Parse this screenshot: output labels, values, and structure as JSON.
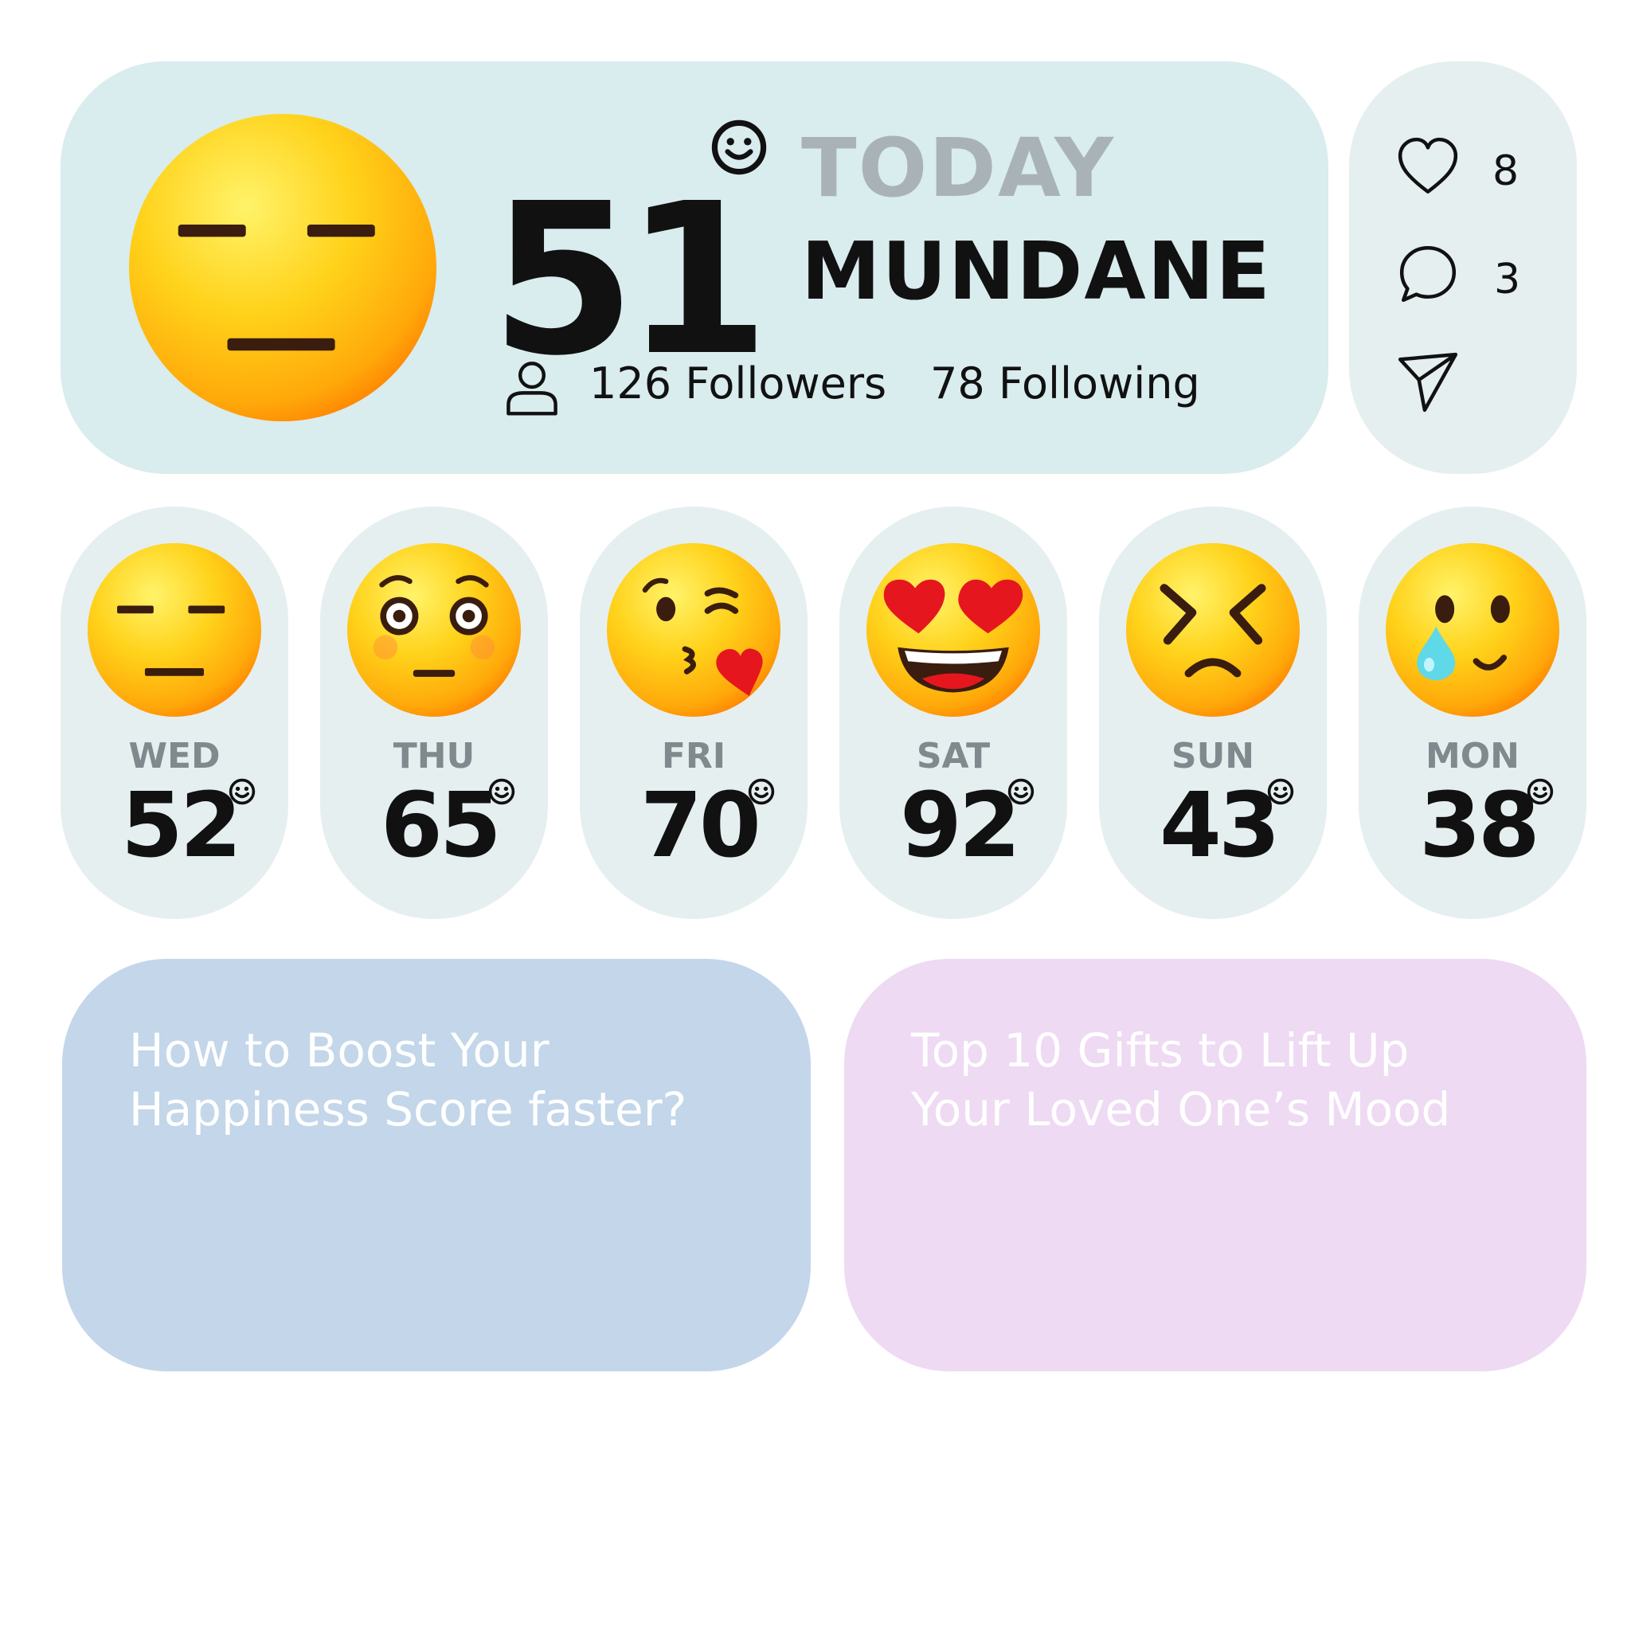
{
  "main": {
    "score": "51",
    "today_label": "TODAY",
    "mood_label": "MUNDANE",
    "followers": "126 Followers",
    "following": "78 Following",
    "emoji_icon": "neutral-face-icon"
  },
  "side": {
    "likes": "8",
    "comments": "3",
    "icons": [
      "heart-icon",
      "comment-icon",
      "send-icon"
    ]
  },
  "days": [
    {
      "name": "WED",
      "score": "52",
      "emoji": "neutral-face-icon"
    },
    {
      "name": "THU",
      "score": "65",
      "emoji": "surprised-face-icon"
    },
    {
      "name": "FRI",
      "score": "70",
      "emoji": "kissing-heart-face-icon"
    },
    {
      "name": "SAT",
      "score": "92",
      "emoji": "heart-eyes-face-icon"
    },
    {
      "name": "SUN",
      "score": "43",
      "emoji": "angry-face-icon"
    },
    {
      "name": "MON",
      "score": "38",
      "emoji": "tearful-smile-face-icon"
    }
  ],
  "articles": [
    {
      "title_line1": "How to Boost Your",
      "title_line2": "Happiness Score faster?"
    },
    {
      "title_line1": "Top 10 Gifts to Lift Up",
      "title_line2": "Your Loved One’s Mood"
    }
  ],
  "colors": {
    "main_card": "#d9ecee",
    "side_card": "#e5eff0",
    "article_blue": "#c3d6ea",
    "article_pink": "#eedaf3",
    "emoji_yellow": "#ffd21a",
    "emoji_orange": "#ff7a00"
  }
}
